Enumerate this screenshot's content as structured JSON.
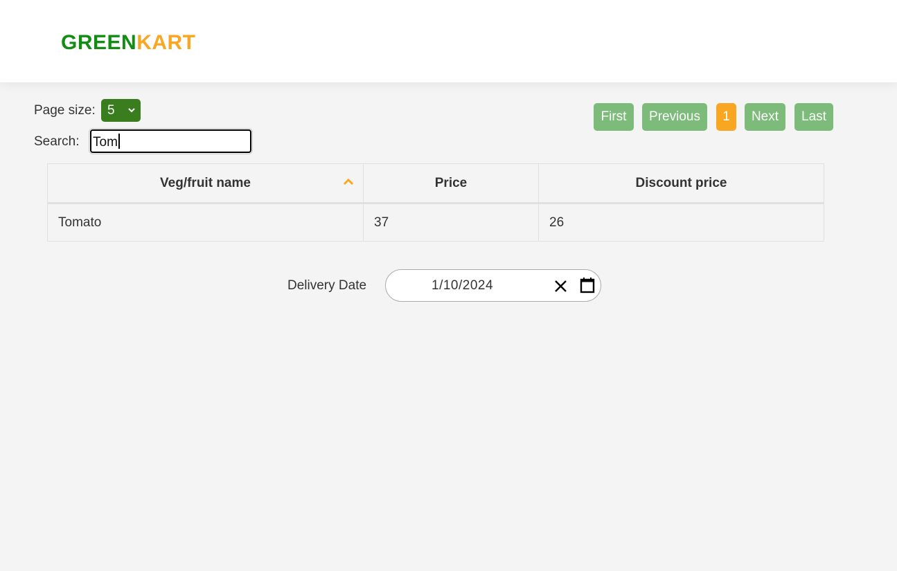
{
  "header": {
    "logo_part1": "GREEN",
    "logo_part2": "KART",
    "logo_colors": {
      "green": "#138c13",
      "kart": "#f9a622"
    }
  },
  "controls": {
    "page_size_label": "Page size:",
    "page_size_value": "5",
    "search_label": "Search:",
    "search_value": "Tom"
  },
  "pagination": {
    "first": "First",
    "previous": "Previous",
    "current_page": "1",
    "next": "Next",
    "last": "Last"
  },
  "table": {
    "columns": [
      "Veg/fruit name",
      "Price",
      "Discount price"
    ],
    "sorted_column": "Veg/fruit name",
    "sort_direction": "ascending",
    "rows": [
      [
        "Tomato",
        "37",
        "26"
      ]
    ]
  },
  "delivery": {
    "label": "Delivery Date",
    "value": "1/10/2024"
  },
  "icons": {
    "page_size_dropdown": "chevron-down-icon",
    "sort": "sort-ascending-icon",
    "clear": "close-icon",
    "calendar": "calendar-icon"
  },
  "colors": {
    "accent_green": "#3a7d1f",
    "pager_green": "#7cbb7a",
    "pager_active": "#f9a622",
    "background": "#f4f4f4"
  }
}
